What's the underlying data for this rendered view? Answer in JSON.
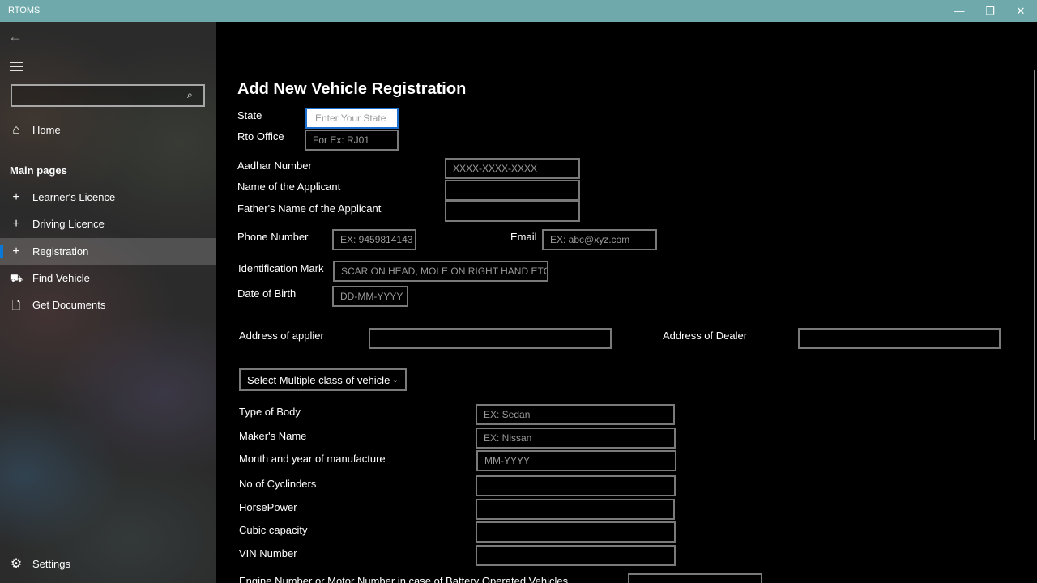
{
  "app": {
    "title": "RTOMS"
  },
  "window_controls": {
    "minimize": "—",
    "restore": "❐",
    "close": "✕"
  },
  "sidebar": {
    "back_icon": "←",
    "search_icon": "⌕",
    "home": {
      "label": "Home",
      "icon": "⌂"
    },
    "section_title": "Main pages",
    "items": [
      {
        "label": "Learner's Licence",
        "icon": "+"
      },
      {
        "label": "Driving Licence",
        "icon": "+"
      },
      {
        "label": "Registration",
        "icon": "+"
      },
      {
        "label": "Find Vehicle",
        "icon": "⛟"
      },
      {
        "label": "Get Documents",
        "icon": "🗋"
      }
    ],
    "settings": {
      "label": "Settings",
      "icon": "⚙"
    }
  },
  "form": {
    "title": "Add New Vehicle Registration",
    "state": {
      "label": "State",
      "placeholder": "Enter Your State"
    },
    "rto_office": {
      "label": "Rto Office",
      "placeholder": "For Ex: RJ01"
    },
    "aadhar": {
      "label": "Aadhar Number",
      "placeholder": "XXXX-XXXX-XXXX"
    },
    "applicant_name": {
      "label": "Name of the Applicant",
      "placeholder": ""
    },
    "father_name": {
      "label": "Father's Name of the Applicant",
      "placeholder": ""
    },
    "phone": {
      "label": "Phone Number",
      "placeholder": "EX: 9459814143"
    },
    "email": {
      "label": "Email",
      "placeholder": "EX: abc@xyz.com"
    },
    "identification_mark": {
      "label": "Identification Mark",
      "placeholder": "SCAR ON HEAD, MOLE ON RIGHT HAND ETC"
    },
    "dob": {
      "label": "Date of Birth",
      "placeholder": "DD-MM-YYYY"
    },
    "address_applier": {
      "label": "Address of applier",
      "placeholder": ""
    },
    "address_dealer": {
      "label": "Address of Dealer",
      "placeholder": ""
    },
    "vehicle_class": {
      "label": "Select Multiple class of vehicle"
    },
    "body_type": {
      "label": "Type of Body",
      "placeholder": "EX: Sedan"
    },
    "maker": {
      "label": "Maker's Name",
      "placeholder": "EX: Nissan"
    },
    "manufacture": {
      "label": "Month and year of manufacture",
      "placeholder": "MM-YYYY"
    },
    "cylinders": {
      "label": "No of Cyclinders",
      "placeholder": ""
    },
    "horsepower": {
      "label": "HorsePower",
      "placeholder": ""
    },
    "cubic_capacity": {
      "label": "Cubic capacity",
      "placeholder": ""
    },
    "vin": {
      "label": "VIN Number",
      "placeholder": ""
    },
    "engine_number": {
      "label": "Engine Number or Motor Number in case of Battery Operated Vehicles",
      "placeholder": ""
    }
  }
}
